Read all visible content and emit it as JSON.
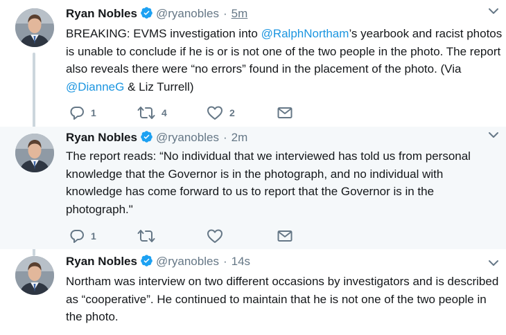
{
  "colors": {
    "link": "#1b95e0",
    "secondary_text": "#657786",
    "thread_line": "#ccd6dd",
    "verified_badge": "#1da1f2",
    "highlight_bg": "#f5f8fa"
  },
  "tweets": [
    {
      "name": "Ryan Nobles",
      "handle": "@ryanobles",
      "separator": "·",
      "time": "5m",
      "text": {
        "p1": "BREAKING: EVMS investigation into ",
        "m1": "@RalphNortham",
        "p2": "’s yearbook and racist photos is unable to conclude if he is or is not one of the two people in the photo. The report also reveals there were “no errors” found in the placement of the photo. (Via ",
        "m2": "@DianneG",
        "p3": " & Liz Turrell)"
      },
      "replies": "1",
      "retweets": "4",
      "likes": "2"
    },
    {
      "name": "Ryan Nobles",
      "handle": "@ryanobles",
      "separator": "·",
      "time": "2m",
      "text": "The report reads: “No individual that we interviewed has told us from personal knowledge that the Governor is in the photograph, and no individual with knowledge has come forward to us to report that the Governor is in the photograph.\"",
      "replies": "1",
      "retweets": "",
      "likes": ""
    },
    {
      "name": "Ryan Nobles",
      "handle": "@ryanobles",
      "separator": "·",
      "time": "14s",
      "text": "Northam was interview on two different occasions by investigators and is described as “cooperative”. He continued to maintain that he is not one of the two people in the photo."
    }
  ],
  "icons": {
    "verified": "verified-badge-icon",
    "caret": "chevron-down-icon",
    "reply": "reply-icon",
    "retweet": "retweet-icon",
    "like": "heart-icon",
    "dm": "envelope-icon"
  }
}
